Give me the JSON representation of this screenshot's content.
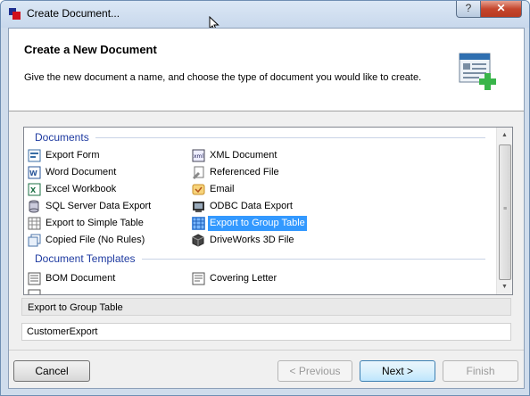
{
  "window": {
    "title": "Create Document...",
    "help_label": "?",
    "close_label": "✕"
  },
  "header": {
    "title": "Create a New Document",
    "description": "Give the new document a name, and choose the type of document you would like to create."
  },
  "list": {
    "groups": [
      {
        "label": "Documents",
        "items": [
          {
            "label": "Export Form",
            "icon": "export-form-icon"
          },
          {
            "label": "XML Document",
            "icon": "xml-document-icon"
          },
          {
            "label": "Word Document",
            "icon": "word-document-icon"
          },
          {
            "label": "Referenced File",
            "icon": "referenced-file-icon"
          },
          {
            "label": "Excel Workbook",
            "icon": "excel-workbook-icon"
          },
          {
            "label": "Email",
            "icon": "email-icon"
          },
          {
            "label": "SQL Server Data Export",
            "icon": "sql-server-icon"
          },
          {
            "label": "ODBC Data Export",
            "icon": "odbc-icon"
          },
          {
            "label": "Export to Simple Table",
            "icon": "simple-table-icon"
          },
          {
            "label": "Export to Group Table",
            "icon": "group-table-icon",
            "selected": true
          },
          {
            "label": "Copied File (No Rules)",
            "icon": "copied-file-icon"
          },
          {
            "label": "DriveWorks 3D File",
            "icon": "driveworks-3d-icon"
          }
        ]
      },
      {
        "label": "Document Templates",
        "items": [
          {
            "label": "BOM Document",
            "icon": "bom-document-icon"
          },
          {
            "label": "Covering Letter",
            "icon": "covering-letter-icon"
          }
        ]
      }
    ]
  },
  "selected_type": "Export to Group Table",
  "name_field": {
    "value": "CustomerExport"
  },
  "buttons": {
    "cancel": "Cancel",
    "previous": "< Previous",
    "next": "Next >",
    "finish": "Finish"
  },
  "colors": {
    "selection": "#3399ff",
    "group_header": "#1e3aa0"
  }
}
